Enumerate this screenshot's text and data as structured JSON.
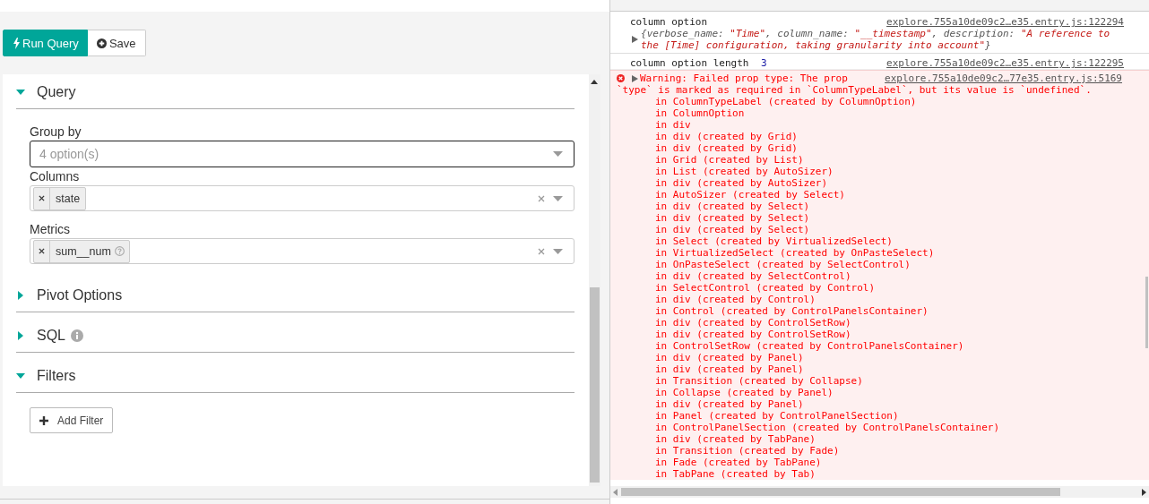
{
  "toolbar": {
    "buttons": [
      {
        "kind": "run",
        "label": "Run Query",
        "primary": true
      },
      {
        "kind": "save",
        "label": "Save",
        "primary": false
      }
    ]
  },
  "sections": [
    {
      "title": "Query",
      "expanded": true,
      "info_icon": false,
      "controls": [
        {
          "kind": "select",
          "label": "Group by",
          "placeholder": "4 option(s)",
          "focused": true
        },
        {
          "kind": "multiselect",
          "label": "Columns",
          "focused": false,
          "tags": [
            {
              "text": "state",
              "help": false
            }
          ]
        },
        {
          "kind": "multiselect",
          "label": "Metrics",
          "focused": false,
          "tags": [
            {
              "text": "sum__num",
              "help": true
            }
          ]
        }
      ]
    },
    {
      "title": "Pivot Options",
      "expanded": false,
      "info_icon": false
    },
    {
      "title": "SQL",
      "expanded": false,
      "info_icon": true
    },
    {
      "title": "Filters",
      "expanded": true,
      "info_icon": false,
      "controls": [
        {
          "kind": "button",
          "label": "Add Filter"
        }
      ]
    }
  ],
  "console": {
    "entries": [
      {
        "kind": "log",
        "message": "column option",
        "source": "explore.755a10de09c2…e35.entry.js:122294"
      },
      {
        "kind": "object",
        "expanded": false,
        "parts": [
          {
            "kind": "punct",
            "text": "{"
          },
          {
            "kind": "key",
            "text": "verbose_name: "
          },
          {
            "kind": "string",
            "text": "\"Time\""
          },
          {
            "kind": "key",
            "text": ", column_name: "
          },
          {
            "kind": "string",
            "text": "\"__timestamp\""
          },
          {
            "kind": "key",
            "text": ", description: "
          },
          {
            "kind": "string",
            "text": "\"A reference to the [Time] configuration, taking granularity into account\""
          },
          {
            "kind": "punct",
            "text": "}"
          }
        ]
      },
      {
        "kind": "log",
        "message": "column option length",
        "number": "3",
        "source": "explore.755a10de09c2…e35.entry.js:122295"
      },
      {
        "kind": "error",
        "expanded": false,
        "message_lines": [
          "Warning: Failed prop type: The prop",
          "`type` is marked as required in `ColumnTypeLabel`, but its value is `undefined`."
        ],
        "source": "explore.755a10de09c2…77e35.entry.js:5169",
        "stack": [
          "in ColumnTypeLabel (created by ColumnOption)",
          "in ColumnOption",
          "in div",
          "in div (created by Grid)",
          "in div (created by Grid)",
          "in Grid (created by List)",
          "in List (created by AutoSizer)",
          "in div (created by AutoSizer)",
          "in AutoSizer (created by Select)",
          "in div (created by Select)",
          "in div (created by Select)",
          "in div (created by Select)",
          "in Select (created by VirtualizedSelect)",
          "in VirtualizedSelect (created by OnPasteSelect)",
          "in OnPasteSelect (created by SelectControl)",
          "in div (created by SelectControl)",
          "in SelectControl (created by Control)",
          "in div (created by Control)",
          "in Control (created by ControlPanelsContainer)",
          "in div (created by ControlSetRow)",
          "in div (created by ControlSetRow)",
          "in ControlSetRow (created by ControlPanelsContainer)",
          "in div (created by Panel)",
          "in div (created by Panel)",
          "in Transition (created by Collapse)",
          "in Collapse (created by Panel)",
          "in div (created by Panel)",
          "in Panel (created by ControlPanelSection)",
          "in ControlPanelSection (created by ControlPanelsContainer)",
          "in div (created by TabPane)",
          "in Transition (created by Fade)",
          "in Fade (created by TabPane)",
          "in TabPane (created by Tab)"
        ]
      }
    ]
  }
}
